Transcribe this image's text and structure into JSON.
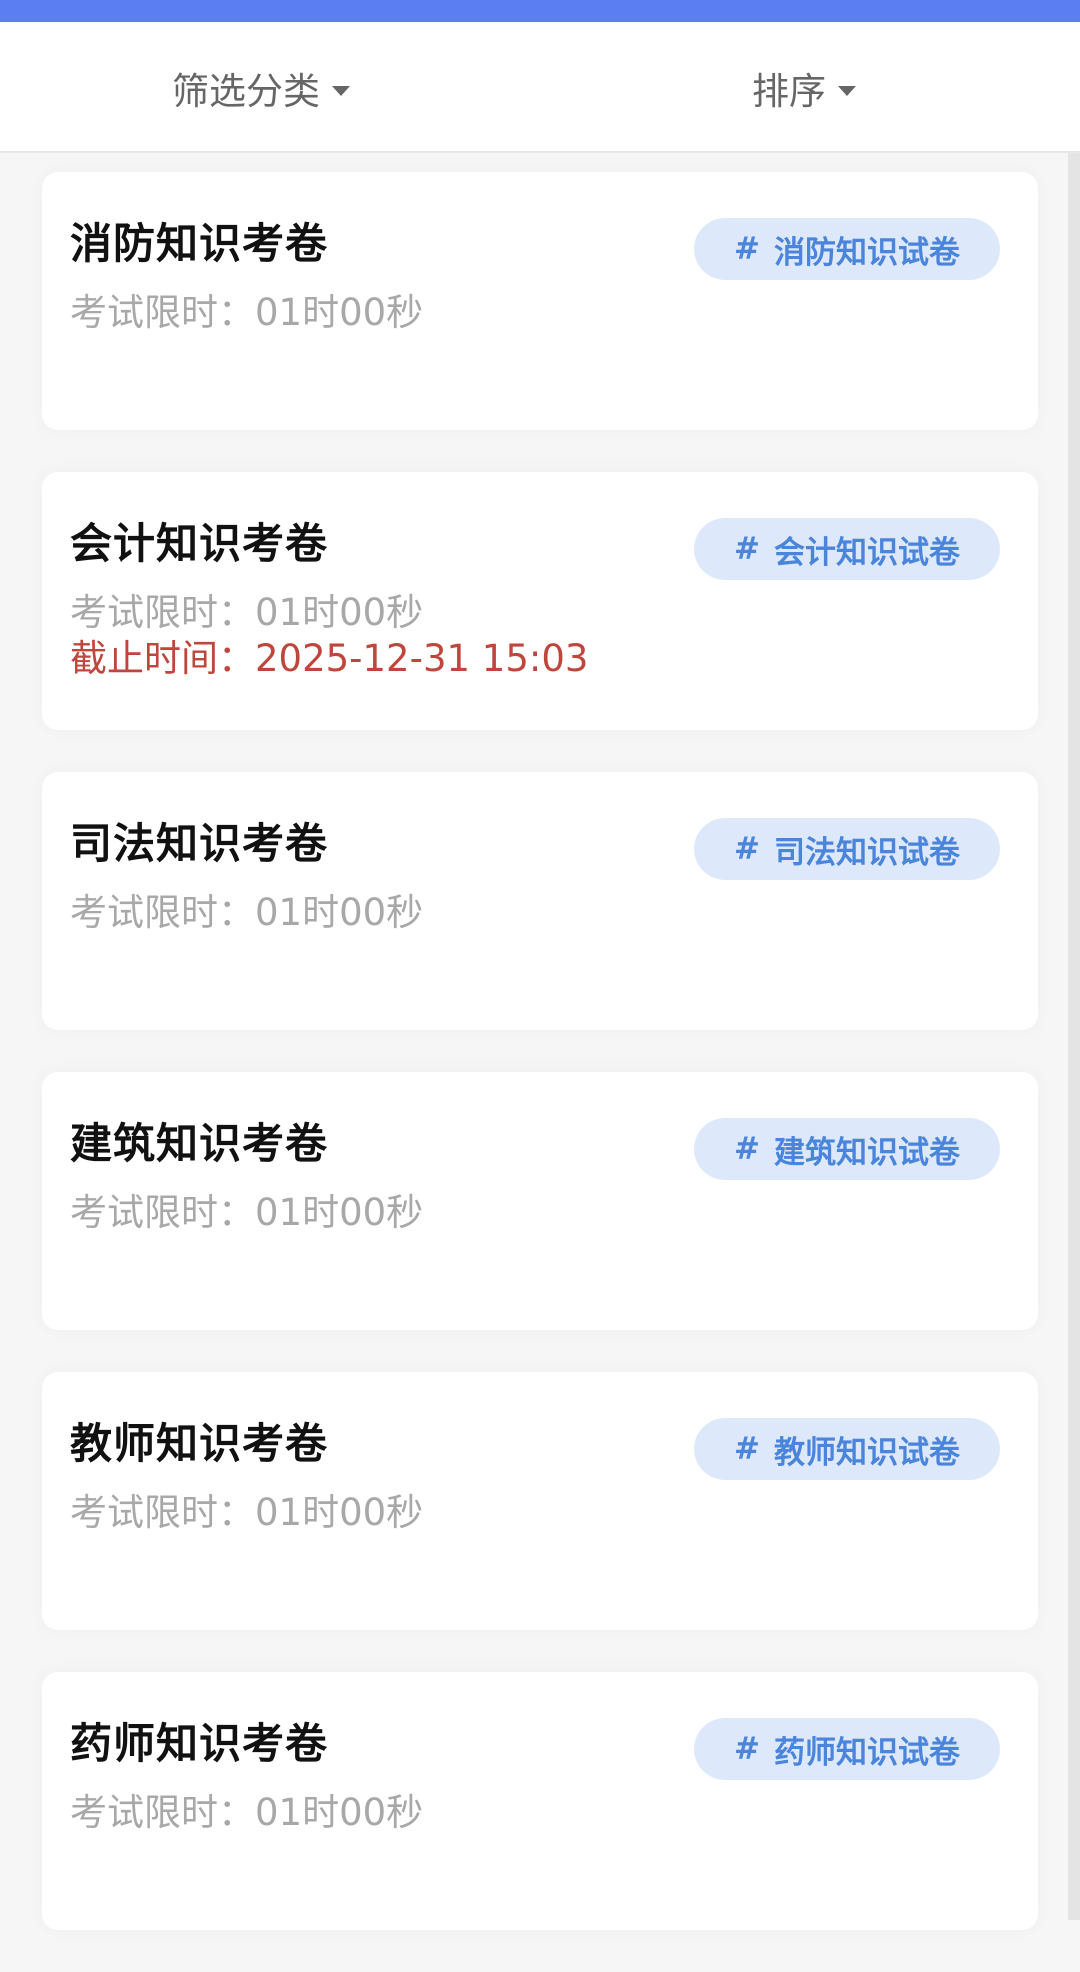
{
  "filter_bar": {
    "category_label": "筛选分类",
    "sort_label": "排序"
  },
  "exams": [
    {
      "title": "消防知识考卷",
      "time_limit": "考试限时：01时00秒",
      "tag_hash": "#",
      "tag": "消防知识试卷"
    },
    {
      "title": "会计知识考卷",
      "time_limit": "考试限时：01时00秒",
      "deadline": "截止时间：2025-12-31 15:03",
      "tag_hash": "#",
      "tag": "会计知识试卷"
    },
    {
      "title": "司法知识考卷",
      "time_limit": "考试限时：01时00秒",
      "tag_hash": "#",
      "tag": "司法知识试卷"
    },
    {
      "title": "建筑知识考卷",
      "time_limit": "考试限时：01时00秒",
      "tag_hash": "#",
      "tag": "建筑知识试卷"
    },
    {
      "title": "教师知识考卷",
      "time_limit": "考试限时：01时00秒",
      "tag_hash": "#",
      "tag": "教师知识试卷"
    },
    {
      "title": "药师知识考卷",
      "time_limit": "考试限时：01时00秒",
      "tag_hash": "#",
      "tag": "药师知识试卷"
    }
  ],
  "colors": {
    "accent": "#5b7ef2",
    "tag_background": "#dde9fb",
    "tag_text": "#4a84db",
    "deadline_text": "#c0463d"
  }
}
